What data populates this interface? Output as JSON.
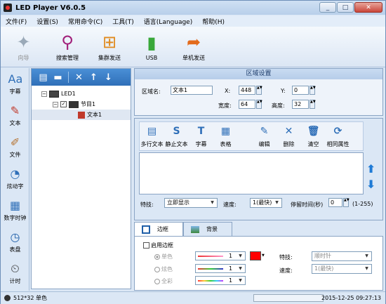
{
  "app": {
    "title": "LED Player V6.0.5"
  },
  "menu": [
    "文件(F)",
    "设置(S)",
    "常用命令(C)",
    "工具(T)",
    "语言(Language)",
    "帮助(H)"
  ],
  "toolbar": {
    "wizard": "向导",
    "search": "搜索管理",
    "cluster": "集群发送",
    "usb": "USB",
    "single": "单机发送"
  },
  "leftbar": [
    "字幕",
    "文本",
    "文件",
    "炫动字",
    "数字时钟",
    "表盘",
    "计时"
  ],
  "tree": {
    "root": "LED1",
    "program": "节目1",
    "item": "文本1"
  },
  "region": {
    "title": "区域设置",
    "name_label": "区域名:",
    "name_value": "文本1",
    "x_label": "X:",
    "x_value": "448",
    "y_label": "Y:",
    "y_value": "0",
    "w_label": "宽度:",
    "w_value": "64",
    "h_label": "高度:",
    "h_value": "32"
  },
  "editor": {
    "tools": [
      "多行文本",
      "静止文本",
      "字幕",
      "表格",
      "编辑",
      "删除",
      "清空",
      "相同属性"
    ],
    "effect_label": "特技:",
    "effect_value": "立即显示",
    "speed_label": "速度:",
    "speed_value": "1(最快)",
    "stay_label": "停留时间(秒)",
    "stay_value": "0",
    "stay_range": "(1-255)"
  },
  "border": {
    "tab_border": "边框",
    "tab_bg": "背景",
    "enable": "启用边框",
    "mode_single": "单色",
    "mode_dazzle": "炫色",
    "mode_full": "全彩",
    "width_value": "1",
    "effect_label": "特技:",
    "effect_value": "顺时针",
    "speed_label": "速度:",
    "speed_value": "1(最快)"
  },
  "status": {
    "size": "512*32 单色",
    "datetime": "2015-12-25 09:27:13"
  },
  "colors": {
    "border_swatch": "#ff0000",
    "accent": "#2f6fb8"
  }
}
